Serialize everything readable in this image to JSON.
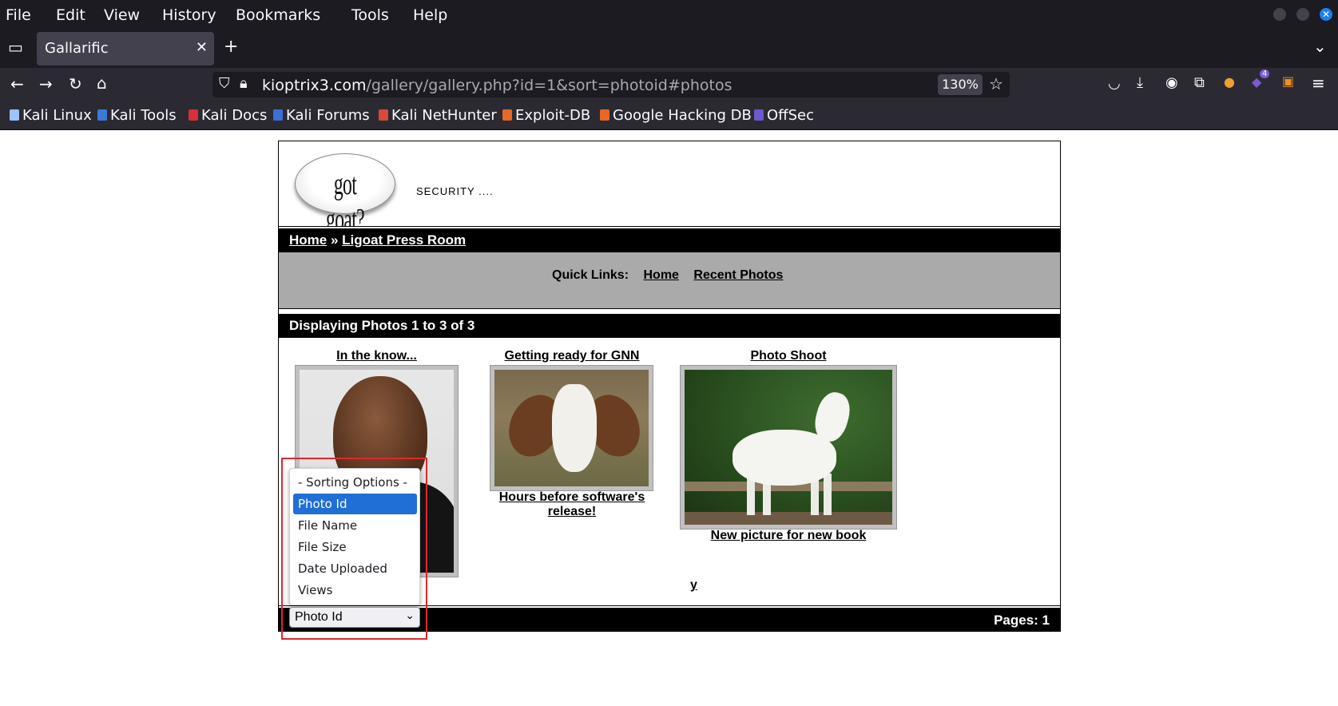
{
  "browser": {
    "menu": [
      "File",
      "Edit",
      "View",
      "History",
      "Bookmarks",
      "Tools",
      "Help"
    ],
    "tab_title": "Gallarific",
    "url_host": "kioptrix3.com",
    "url_path": "/gallery/gallery.php?id=1&sort=photoid#photos",
    "zoom": "130%",
    "bookmarks": [
      "Kali Linux",
      "Kali Tools",
      "Kali Docs",
      "Kali Forums",
      "Kali NetHunter",
      "Exploit-DB",
      "Google Hacking DB",
      "OffSec"
    ],
    "extension_badge": "4"
  },
  "site": {
    "logo_text": "got goat?",
    "tagline": "SECURITY ....",
    "breadcrumb": {
      "home": "Home",
      "sep": "»",
      "current": "Ligoat Press Room"
    },
    "quick_links": {
      "label": "Quick Links:",
      "home": "Home",
      "recent": "Recent Photos"
    },
    "displaying": "Displaying Photos 1 to 3 of 3",
    "photos": [
      {
        "title": "In the know...",
        "caption": "y"
      },
      {
        "title": "Getting ready for GNN",
        "caption_line1": "Hours before software's",
        "caption_line2": "release!"
      },
      {
        "title": "Photo Shoot",
        "caption": "New picture for new book"
      }
    ],
    "pages": "Pages: 1"
  },
  "sort_select": {
    "selected": "Photo Id",
    "options": [
      "- Sorting Options -",
      "Photo Id",
      "File Name",
      "File Size",
      "Date Uploaded",
      "Views"
    ]
  }
}
